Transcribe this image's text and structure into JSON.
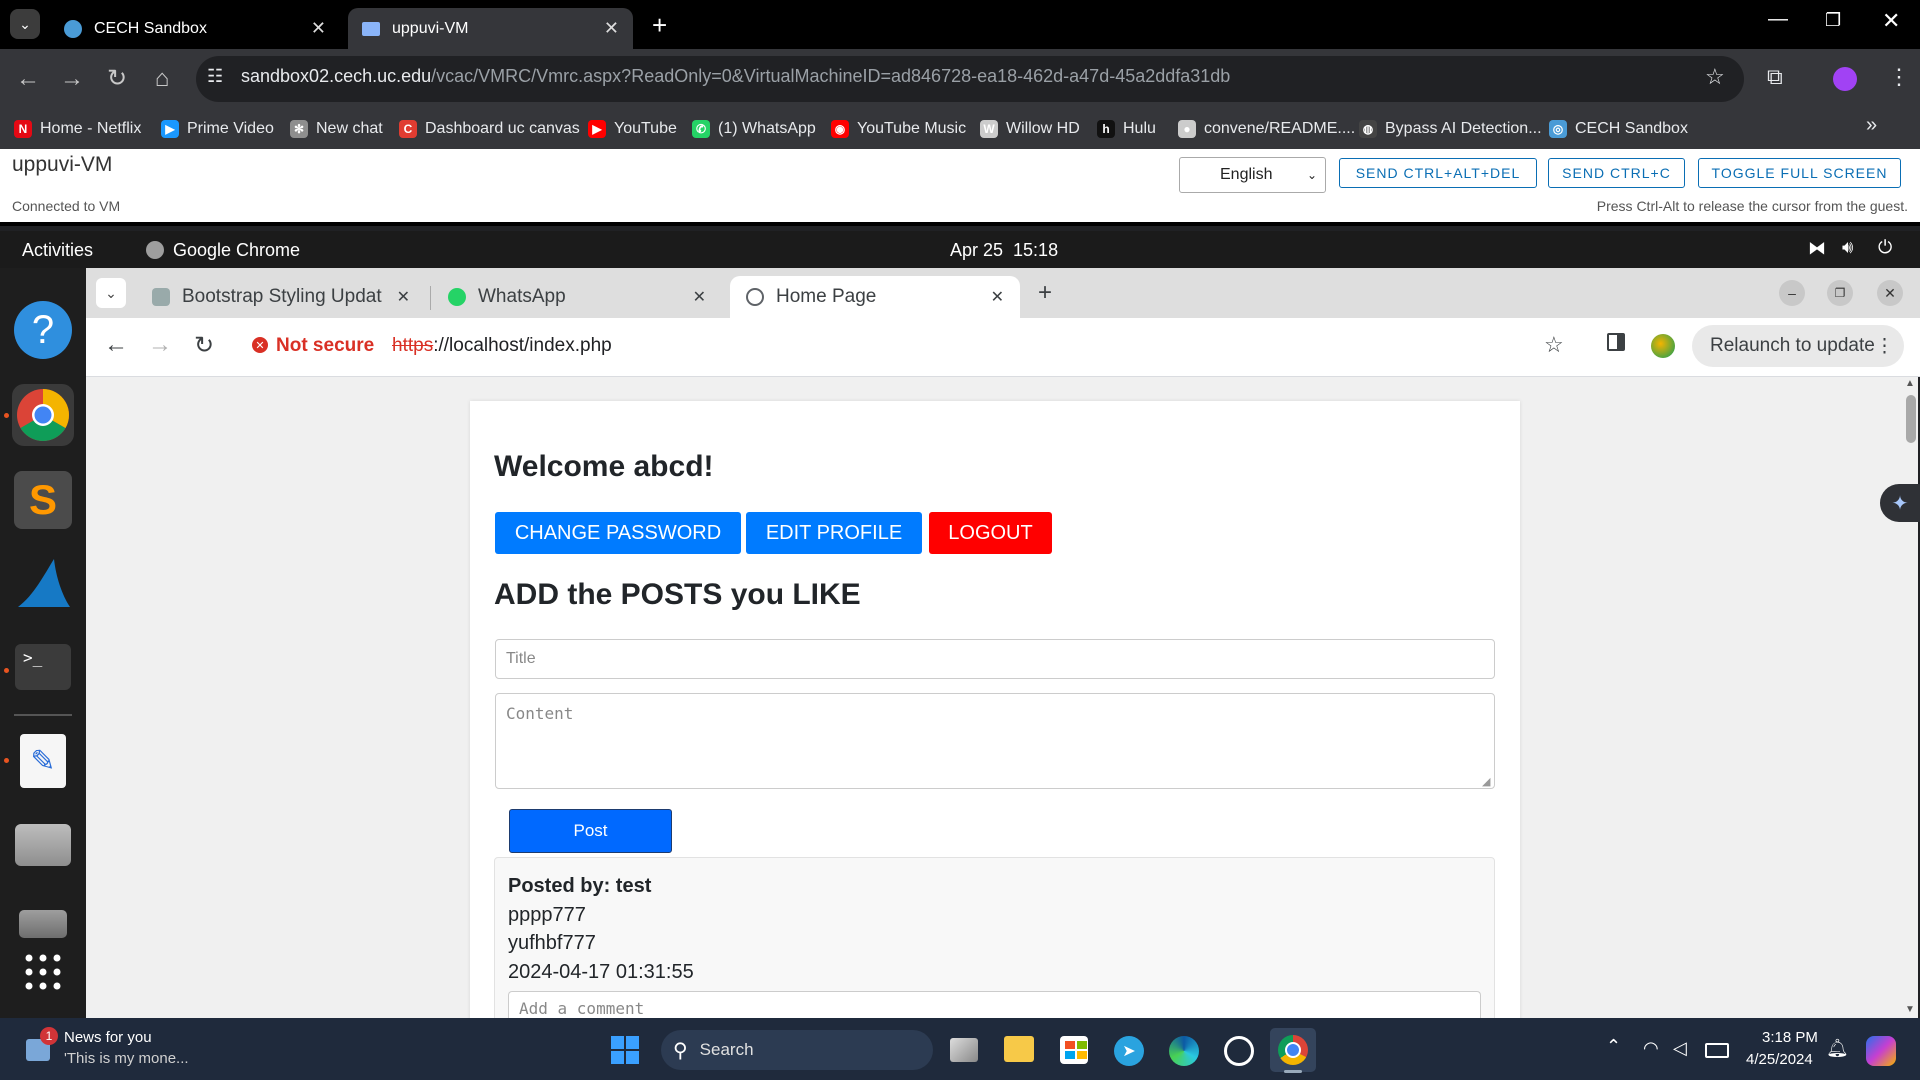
{
  "host_browser": {
    "tabs": [
      {
        "label": "CECH Sandbox",
        "active": false
      },
      {
        "label": "uppuvi-VM",
        "active": true
      }
    ],
    "url_host": "sandbox02.cech.uc.edu",
    "url_rest": "/vcac/VMRC/Vmrc.aspx?ReadOnly=0&VirtualMachineID=ad846728-ea18-462d-a47d-45a2ddfa31db",
    "bookmarks": [
      {
        "label": "Home - Netflix",
        "icon": "netflix-icon",
        "color": "#e50914",
        "glyph": "N"
      },
      {
        "label": "Prime Video",
        "icon": "prime-video-icon",
        "color": "#1a98ff",
        "glyph": "▶"
      },
      {
        "label": "New chat",
        "icon": "chatgpt-icon",
        "color": "#8e8e8e",
        "glyph": "✻"
      },
      {
        "label": "Dashboard uc canvas",
        "icon": "canvas-icon",
        "color": "#e03c31",
        "glyph": "C"
      },
      {
        "label": "YouTube",
        "icon": "youtube-icon",
        "color": "#ff0000",
        "glyph": "▶"
      },
      {
        "label": "(1) WhatsApp",
        "icon": "whatsapp-icon",
        "color": "#25d366",
        "glyph": "✆"
      },
      {
        "label": "YouTube Music",
        "icon": "youtube-music-icon",
        "color": "#ff0000",
        "glyph": "◉"
      },
      {
        "label": "Willow HD",
        "icon": "willow-icon",
        "color": "#cccccc",
        "glyph": "W"
      },
      {
        "label": "Hulu",
        "icon": "hulu-icon",
        "color": "#111111",
        "glyph": "h"
      },
      {
        "label": "convene/README....",
        "icon": "github-icon",
        "color": "#cccccc",
        "glyph": "●"
      },
      {
        "label": "Bypass AI Detection...",
        "icon": "bypass-icon",
        "color": "#444444",
        "glyph": "◍"
      },
      {
        "label": "CECH Sandbox",
        "icon": "cech-icon",
        "color": "#4a9bd6",
        "glyph": "◎"
      }
    ]
  },
  "vmrc": {
    "vm_name": "uppuvi-VM",
    "status": "Connected to VM",
    "language": "English",
    "buttons": [
      "SEND CTRL+ALT+DEL",
      "SEND CTRL+C",
      "TOGGLE FULL SCREEN"
    ],
    "hint": "Press Ctrl-Alt to release the cursor from the guest."
  },
  "ubuntu": {
    "activities": "Activities",
    "app": "Google Chrome",
    "clock": "Apr 25  15:18"
  },
  "guest_browser": {
    "tabs": [
      {
        "label": "Bootstrap Styling Updat",
        "active": false
      },
      {
        "label": "WhatsApp",
        "active": false
      },
      {
        "label": "Home Page",
        "active": true
      }
    ],
    "security": "Not secure",
    "url_scheme": "https",
    "url_rest": "://localhost/index.php",
    "relaunch": "Relaunch to update"
  },
  "page": {
    "welcome": "Welcome abcd!",
    "buttons": {
      "change_password": "CHANGE PASSWORD",
      "edit_profile": "EDIT PROFILE",
      "logout": "LOGOUT"
    },
    "heading": "ADD the POSTS you LIKE",
    "title_placeholder": "Title",
    "content_placeholder": "Content",
    "post_button": "Post",
    "post": {
      "author_line": "Posted by: test",
      "title": "pppp777",
      "content": "yufhbf777",
      "timestamp": "2024-04-17 01:31:55",
      "comment_placeholder": "Add a comment"
    },
    "colors": {
      "primary": "#007bff",
      "danger": "#ff0000",
      "post_blue": "#0069ff"
    }
  },
  "taskbar": {
    "news_title": "News for you",
    "news_sub": "'This is my mone...",
    "news_badge": "1",
    "search": "Search",
    "time": "3:18 PM",
    "date": "4/25/2024"
  }
}
